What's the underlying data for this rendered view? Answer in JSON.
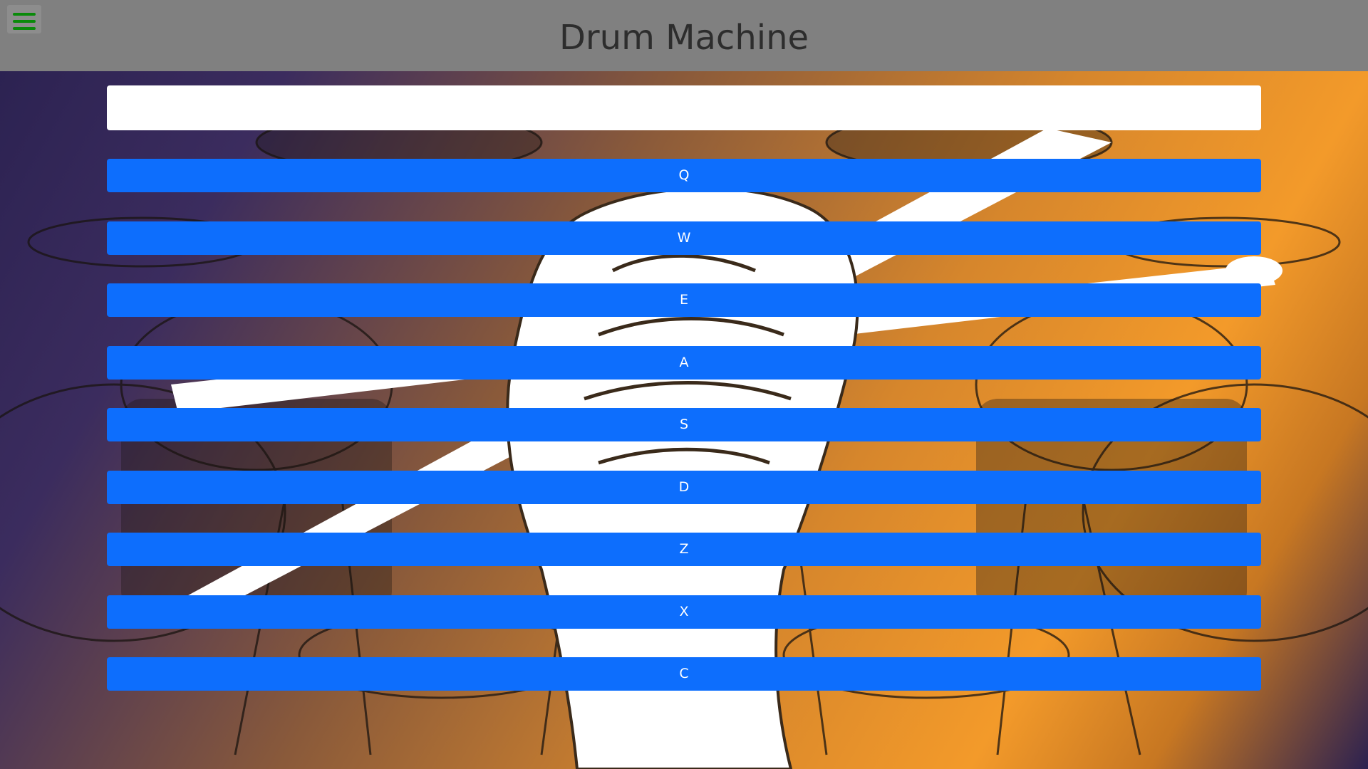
{
  "header": {
    "title": "Drum Machine",
    "menu_icon": "hamburger-icon",
    "menu_icon_color": "#0a8a0a"
  },
  "display": {
    "text": ""
  },
  "pads": [
    {
      "key": "Q"
    },
    {
      "key": "W"
    },
    {
      "key": "E"
    },
    {
      "key": "A"
    },
    {
      "key": "S"
    },
    {
      "key": "D"
    },
    {
      "key": "Z"
    },
    {
      "key": "X"
    },
    {
      "key": "C"
    }
  ],
  "colors": {
    "header_bg": "#808080",
    "pad_bg": "#0d6efd",
    "pad_text": "#ffffff",
    "display_bg": "#ffffff"
  }
}
